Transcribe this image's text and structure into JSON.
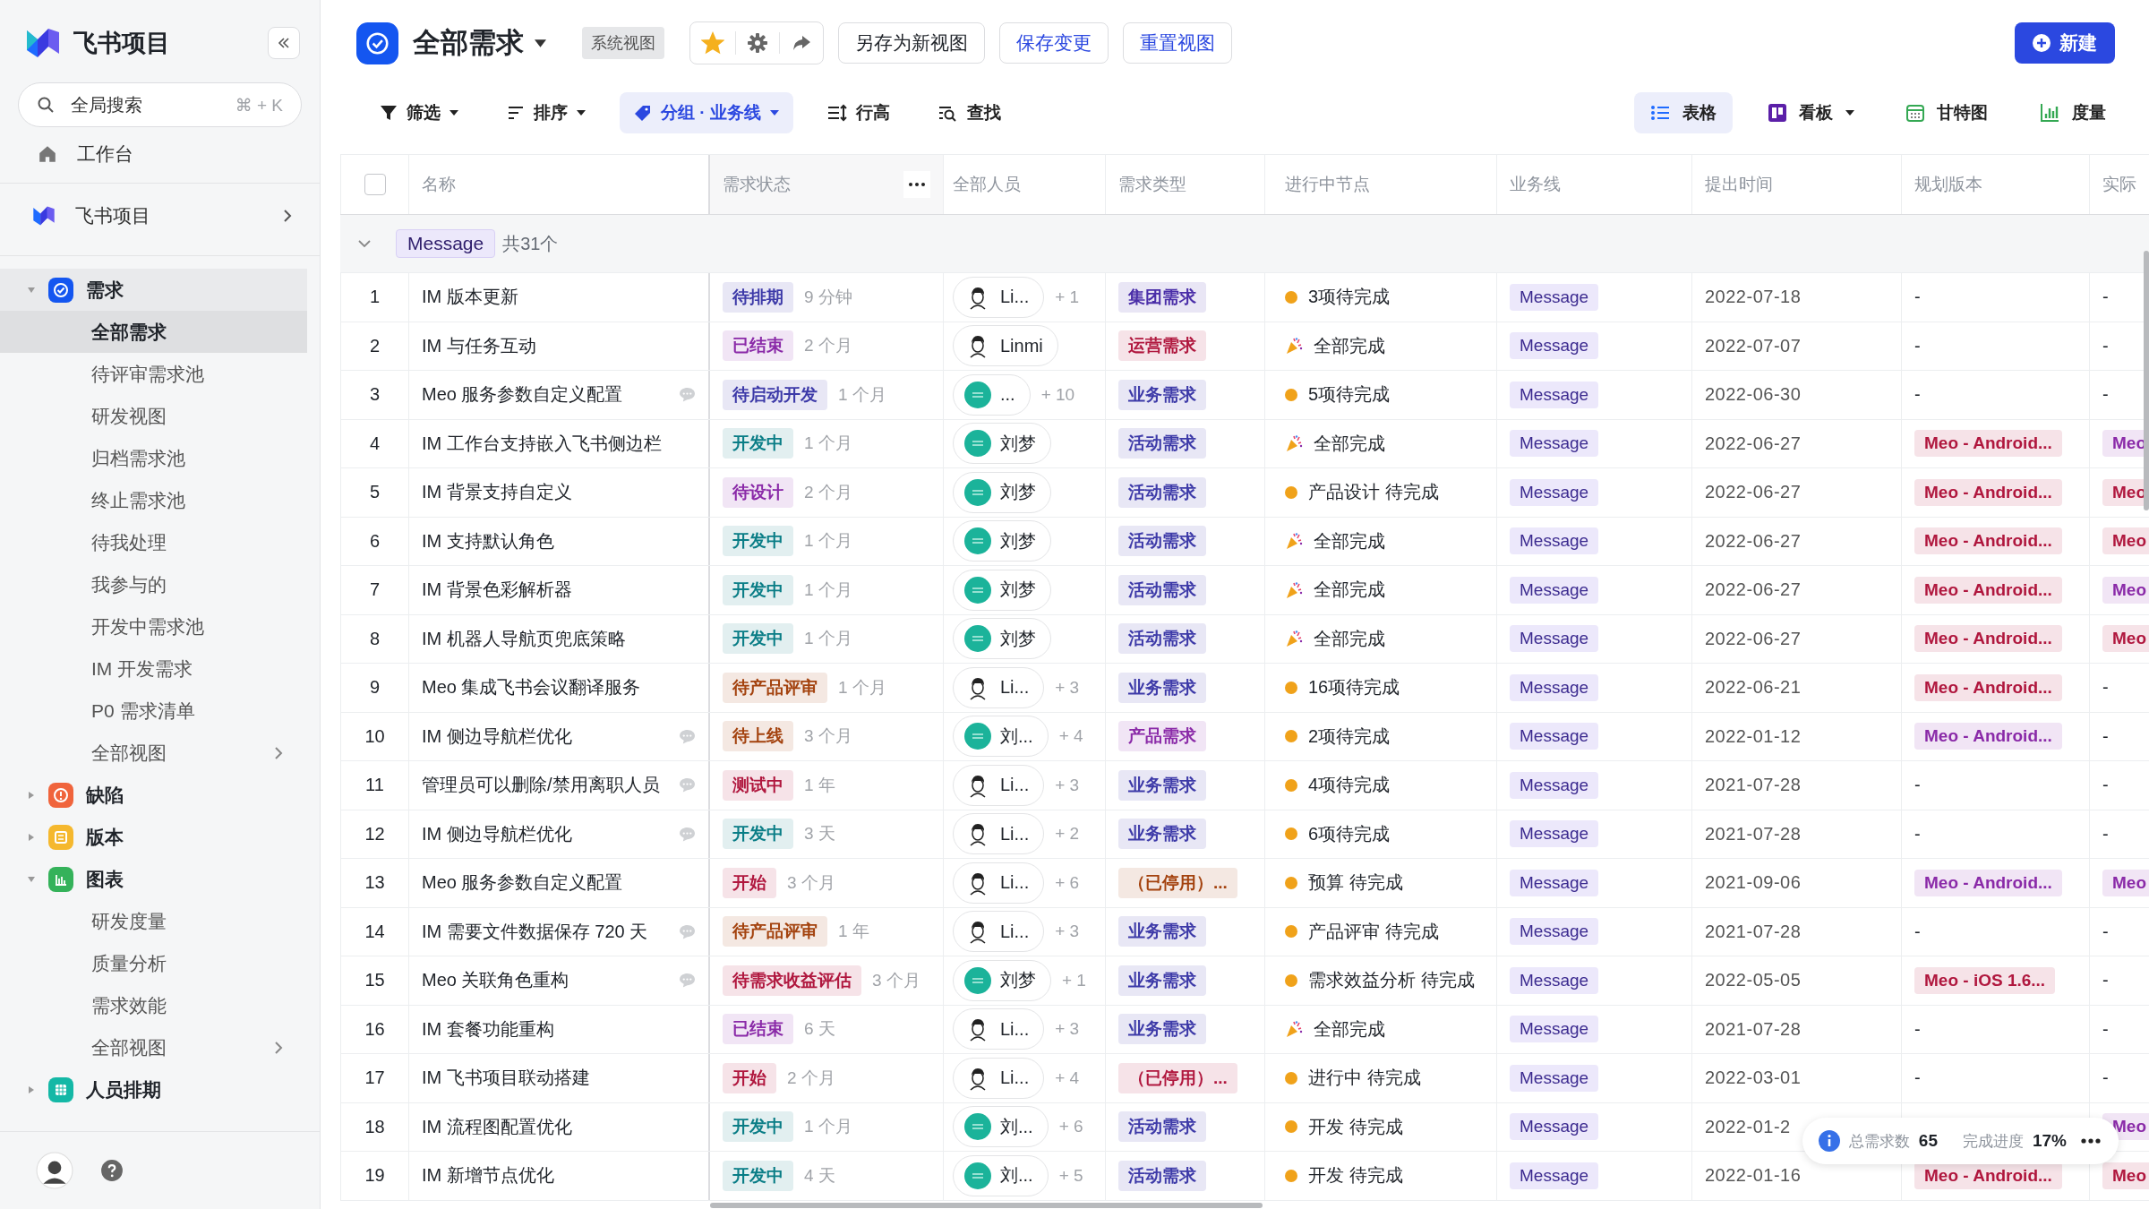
{
  "sidebar": {
    "app_name": "飞书项目",
    "search": {
      "placeholder": "全局搜索",
      "shortcut": "⌘ + K"
    },
    "workbench": "工作台",
    "project": "飞书项目",
    "tree": [
      {
        "label": "需求",
        "color": "#1456f0",
        "expanded": true,
        "children": [
          {
            "label": "全部需求",
            "selected": true,
            "submenu": false
          },
          {
            "label": "待评审需求池",
            "selected": false,
            "submenu": false
          },
          {
            "label": "研发视图",
            "selected": false,
            "submenu": false
          },
          {
            "label": "归档需求池",
            "selected": false,
            "submenu": false
          },
          {
            "label": "终止需求池",
            "selected": false,
            "submenu": false
          },
          {
            "label": "待我处理",
            "selected": false,
            "submenu": false
          },
          {
            "label": "我参与的",
            "selected": false,
            "submenu": false
          },
          {
            "label": "开发中需求池",
            "selected": false,
            "submenu": false
          },
          {
            "label": "IM 开发需求",
            "selected": false,
            "submenu": false
          },
          {
            "label": "P0 需求清单",
            "selected": false,
            "submenu": false
          },
          {
            "label": "全部视图",
            "selected": false,
            "submenu": true
          }
        ]
      },
      {
        "label": "缺陷",
        "color": "#f0643c",
        "expanded": false
      },
      {
        "label": "版本",
        "color": "#f5b82e",
        "expanded": false
      },
      {
        "label": "图表",
        "color": "#34b25a",
        "expanded": true,
        "children": [
          {
            "label": "研发度量",
            "selected": false,
            "submenu": false
          },
          {
            "label": "质量分析",
            "selected": false,
            "submenu": false
          },
          {
            "label": "需求效能",
            "selected": false,
            "submenu": false
          },
          {
            "label": "全部视图",
            "selected": false,
            "submenu": true
          }
        ]
      },
      {
        "label": "人员排期",
        "color": "#14b8a6",
        "expanded": false
      }
    ]
  },
  "header": {
    "title": "全部需求",
    "badge": "系统视图",
    "starred": true,
    "buttons": [
      {
        "label": "另存为新视图",
        "kind": "default"
      },
      {
        "label": "保存变更",
        "kind": "accent"
      },
      {
        "label": "重置视图",
        "kind": "accent"
      }
    ],
    "new_button": "新建"
  },
  "toolbar": [
    {
      "label": "筛选",
      "dropdown": true,
      "selected": false
    },
    {
      "label": "排序",
      "dropdown": true,
      "selected": false
    },
    {
      "label": "分组 · 业务线",
      "dropdown": true,
      "selected": true
    },
    {
      "label": "行高",
      "dropdown": false,
      "selected": false
    },
    {
      "label": "查找",
      "dropdown": false,
      "selected": false
    }
  ],
  "views": [
    {
      "label": "表格",
      "dropdown": false,
      "selected": true
    },
    {
      "label": "看板",
      "dropdown": true,
      "selected": false
    },
    {
      "label": "甘特图",
      "dropdown": false,
      "selected": false
    },
    {
      "label": "度量",
      "dropdown": false,
      "selected": false
    }
  ],
  "table": {
    "select_all": {
      "checked": false
    },
    "columns": [
      {
        "label": "名称"
      },
      {
        "label": "需求状态",
        "menu": true
      },
      {
        "label": "全部人员"
      },
      {
        "label": "需求类型"
      },
      {
        "label": "进行中节点"
      },
      {
        "label": "业务线"
      },
      {
        "label": "提出时间"
      },
      {
        "label": "规划版本"
      },
      {
        "label": "实际"
      }
    ],
    "group": {
      "expanded": true,
      "label": "Message",
      "count": "共31个"
    },
    "rows": [
      {
        "no": "1",
        "name": "IM 版本更新",
        "comment": false,
        "status": {
          "text": "待排期",
          "color": "#3d3aa8"
        },
        "age": "9 分钟",
        "person": {
          "kind": "face",
          "name": "Li..."
        },
        "extra": "+ 1",
        "type": {
          "text": "集团需求",
          "color": "#4a2ea8"
        },
        "node": {
          "kind": "pending",
          "text": "3项待完成"
        },
        "line": "Message",
        "date": "2022-07-18",
        "version": {
          "text": "-"
        },
        "actual": {
          "text": "-"
        }
      },
      {
        "no": "2",
        "name": "IM 与任务互动",
        "comment": false,
        "status": {
          "text": "已结束",
          "color": "#8a2aa8"
        },
        "age": "2 个月",
        "person": {
          "kind": "face",
          "name": "Linmi"
        },
        "type": {
          "text": "运营需求",
          "color": "#b0173e"
        },
        "node": {
          "kind": "done",
          "text": "全部完成"
        },
        "line": "Message",
        "date": "2022-07-07",
        "version": {
          "text": "-"
        },
        "actual": {
          "text": "-"
        }
      },
      {
        "no": "3",
        "name": "Meo 服务参数自定义配置",
        "comment": true,
        "status": {
          "text": "待启动开发",
          "color": "#3d3aa8"
        },
        "age": "1 个月",
        "person": {
          "kind": "teal",
          "name": "..."
        },
        "extra": "+ 10",
        "type": {
          "text": "业务需求",
          "color": "#3d3aa8"
        },
        "node": {
          "kind": "pending",
          "text": "5项待完成"
        },
        "line": "Message",
        "date": "2022-06-30",
        "version": {
          "text": "-"
        },
        "actual": {
          "text": "-"
        }
      },
      {
        "no": "4",
        "name": "IM 工作台支持嵌入飞书侧边栏",
        "comment": false,
        "status": {
          "text": "开发中",
          "color": "#0a7d86"
        },
        "age": "1 个月",
        "person": {
          "kind": "teal",
          "name": "刘梦"
        },
        "type": {
          "text": "活动需求",
          "color": "#3d3aa8"
        },
        "node": {
          "kind": "done",
          "text": "全部完成"
        },
        "line": "Message",
        "date": "2022-06-27",
        "version": {
          "text": "Meo - Android...",
          "color": "#b0173e"
        },
        "actual": {
          "text": "Meo",
          "color": "#8a2aa8"
        }
      },
      {
        "no": "5",
        "name": "IM 背景支持自定义",
        "comment": false,
        "status": {
          "text": "待设计",
          "color": "#8a2aa8"
        },
        "age": "2 个月",
        "person": {
          "kind": "teal",
          "name": "刘梦"
        },
        "type": {
          "text": "活动需求",
          "color": "#3d3aa8"
        },
        "node": {
          "kind": "pending",
          "text": "产品设计 待完成"
        },
        "line": "Message",
        "date": "2022-06-27",
        "version": {
          "text": "Meo - Android...",
          "color": "#b0173e"
        },
        "actual": {
          "text": "Meo",
          "color": "#b0173e"
        }
      },
      {
        "no": "6",
        "name": "IM 支持默认角色",
        "comment": false,
        "status": {
          "text": "开发中",
          "color": "#0a7d86"
        },
        "age": "1 个月",
        "person": {
          "kind": "teal",
          "name": "刘梦"
        },
        "type": {
          "text": "活动需求",
          "color": "#3d3aa8"
        },
        "node": {
          "kind": "done",
          "text": "全部完成"
        },
        "line": "Message",
        "date": "2022-06-27",
        "version": {
          "text": "Meo - Android...",
          "color": "#b0173e"
        },
        "actual": {
          "text": "Meo",
          "color": "#b0173e"
        }
      },
      {
        "no": "7",
        "name": "IM 背景色彩解析器",
        "comment": false,
        "status": {
          "text": "开发中",
          "color": "#0a7d86"
        },
        "age": "1 个月",
        "person": {
          "kind": "teal",
          "name": "刘梦"
        },
        "type": {
          "text": "活动需求",
          "color": "#3d3aa8"
        },
        "node": {
          "kind": "done",
          "text": "全部完成"
        },
        "line": "Message",
        "date": "2022-06-27",
        "version": {
          "text": "Meo - Android...",
          "color": "#b0173e"
        },
        "actual": {
          "text": "Meo",
          "color": "#8a2aa8"
        }
      },
      {
        "no": "8",
        "name": "IM 机器人导航页兜底策略",
        "comment": false,
        "status": {
          "text": "开发中",
          "color": "#0a7d86"
        },
        "age": "1 个月",
        "person": {
          "kind": "teal",
          "name": "刘梦"
        },
        "type": {
          "text": "活动需求",
          "color": "#3d3aa8"
        },
        "node": {
          "kind": "done",
          "text": "全部完成"
        },
        "line": "Message",
        "date": "2022-06-27",
        "version": {
          "text": "Meo - Android...",
          "color": "#b0173e"
        },
        "actual": {
          "text": "Meo",
          "color": "#b0173e"
        }
      },
      {
        "no": "9",
        "name": "Meo 集成飞书会议翻译服务",
        "comment": false,
        "status": {
          "text": "待产品评审",
          "color": "#a3420e"
        },
        "age": "1 个月",
        "person": {
          "kind": "face",
          "name": "Li..."
        },
        "extra": "+ 3",
        "type": {
          "text": "业务需求",
          "color": "#3d3aa8"
        },
        "node": {
          "kind": "pending",
          "text": "16项待完成"
        },
        "line": "Message",
        "date": "2022-06-21",
        "version": {
          "text": "Meo - Android...",
          "color": "#b0173e"
        },
        "actual": {
          "text": "-"
        }
      },
      {
        "no": "10",
        "name": "IM 侧边导航栏优化",
        "comment": true,
        "status": {
          "text": "待上线",
          "color": "#a3420e"
        },
        "age": "3 个月",
        "person": {
          "kind": "teal",
          "name": "刘..."
        },
        "extra": "+ 4",
        "type": {
          "text": "产品需求",
          "color": "#8a2aa8"
        },
        "node": {
          "kind": "pending",
          "text": "2项待完成"
        },
        "line": "Message",
        "date": "2022-01-12",
        "version": {
          "text": "Meo - Android...",
          "color": "#8a2aa8"
        },
        "actual": {
          "text": "-"
        }
      },
      {
        "no": "11",
        "name": "管理员可以删除/禁用离职人员",
        "comment": true,
        "status": {
          "text": "测试中",
          "color": "#b0173e"
        },
        "age": "1 年",
        "person": {
          "kind": "face",
          "name": "Li..."
        },
        "extra": "+ 3",
        "type": {
          "text": "业务需求",
          "color": "#3d3aa8"
        },
        "node": {
          "kind": "pending",
          "text": "4项待完成"
        },
        "line": "Message",
        "date": "2021-07-28",
        "version": {
          "text": "-"
        },
        "actual": {
          "text": "-"
        }
      },
      {
        "no": "12",
        "name": "IM 侧边导航栏优化",
        "comment": true,
        "status": {
          "text": "开发中",
          "color": "#0a7d86"
        },
        "age": "3 天",
        "person": {
          "kind": "face",
          "name": "Li..."
        },
        "extra": "+ 2",
        "type": {
          "text": "业务需求",
          "color": "#3d3aa8"
        },
        "node": {
          "kind": "pending",
          "text": "6项待完成"
        },
        "line": "Message",
        "date": "2021-07-28",
        "version": {
          "text": "-"
        },
        "actual": {
          "text": "-"
        }
      },
      {
        "no": "13",
        "name": "Meo 服务参数自定义配置",
        "comment": false,
        "status": {
          "text": "开始",
          "color": "#b0173e"
        },
        "age": "3 个月",
        "person": {
          "kind": "face",
          "name": "Li..."
        },
        "extra": "+ 6",
        "type": {
          "text": "（已停用）...",
          "color": "#a3420e"
        },
        "node": {
          "kind": "pending",
          "text": "预算 待完成"
        },
        "line": "Message",
        "date": "2021-09-06",
        "version": {
          "text": "Meo - Android...",
          "color": "#8a2aa8"
        },
        "actual": {
          "text": "Meo",
          "color": "#8a2aa8"
        }
      },
      {
        "no": "14",
        "name": "IM 需要文件数据保存 720 天",
        "comment": true,
        "status": {
          "text": "待产品评审",
          "color": "#a3420e"
        },
        "age": "1 年",
        "person": {
          "kind": "face",
          "name": "Li..."
        },
        "extra": "+ 3",
        "type": {
          "text": "业务需求",
          "color": "#3d3aa8"
        },
        "node": {
          "kind": "pending",
          "text": "产品评审 待完成"
        },
        "line": "Message",
        "date": "2021-07-28",
        "version": {
          "text": "-"
        },
        "actual": {
          "text": "-"
        }
      },
      {
        "no": "15",
        "name": "Meo 关联角色重构",
        "comment": true,
        "status": {
          "text": "待需求收益评估",
          "color": "#b0173e"
        },
        "age": "3 个月",
        "person": {
          "kind": "teal",
          "name": "刘梦"
        },
        "extra": "+ 1",
        "type": {
          "text": "业务需求",
          "color": "#3d3aa8"
        },
        "node": {
          "kind": "pending",
          "text": "需求效益分析 待完成"
        },
        "line": "Message",
        "date": "2022-05-05",
        "version": {
          "text": "Meo - iOS 1.6...",
          "color": "#b0173e"
        },
        "actual": {
          "text": "-"
        }
      },
      {
        "no": "16",
        "name": "IM 套餐功能重构",
        "comment": false,
        "status": {
          "text": "已结束",
          "color": "#8a2aa8"
        },
        "age": "6 天",
        "person": {
          "kind": "face",
          "name": "Li..."
        },
        "extra": "+ 3",
        "type": {
          "text": "业务需求",
          "color": "#3d3aa8"
        },
        "node": {
          "kind": "done",
          "text": "全部完成"
        },
        "line": "Message",
        "date": "2021-07-28",
        "version": {
          "text": "-"
        },
        "actual": {
          "text": "-"
        }
      },
      {
        "no": "17",
        "name": "IM 飞书项目联动搭建",
        "comment": false,
        "status": {
          "text": "开始",
          "color": "#b0173e"
        },
        "age": "2 个月",
        "person": {
          "kind": "face",
          "name": "Li..."
        },
        "extra": "+ 4",
        "type": {
          "text": "（已停用）...",
          "color": "#b0173e"
        },
        "node": {
          "kind": "pending",
          "text": "进行中 待完成"
        },
        "line": "Message",
        "date": "2022-03-01",
        "version": {
          "text": "-"
        },
        "actual": {
          "text": "-"
        }
      },
      {
        "no": "18",
        "name": "IM 流程图配置优化",
        "comment": false,
        "status": {
          "text": "开发中",
          "color": "#0a7d86"
        },
        "age": "1 个月",
        "person": {
          "kind": "teal",
          "name": "刘..."
        },
        "extra": "+ 6",
        "type": {
          "text": "活动需求",
          "color": "#3d3aa8"
        },
        "node": {
          "kind": "pending",
          "text": "开发 待完成"
        },
        "line": "Message",
        "date": "2022-01-2",
        "actual": {
          "text": "Meo",
          "color": "#8a2aa8"
        }
      },
      {
        "no": "19",
        "name": "IM 新增节点优化",
        "comment": false,
        "status": {
          "text": "开发中",
          "color": "#0a7d86"
        },
        "age": "4 天",
        "person": {
          "kind": "teal",
          "name": "刘..."
        },
        "extra": "+ 5",
        "type": {
          "text": "活动需求",
          "color": "#3d3aa8"
        },
        "node": {
          "kind": "pending",
          "text": "开发 待完成"
        },
        "line": "Message",
        "date": "2022-01-16",
        "version": {
          "text": "Meo - Android...",
          "color": "#b0173e"
        },
        "actual": {
          "text": "Meo",
          "color": "#b0173e"
        }
      }
    ]
  },
  "summary": {
    "total_label": "总需求数",
    "total": "65",
    "progress_label": "完成进度",
    "progress": "17%"
  }
}
